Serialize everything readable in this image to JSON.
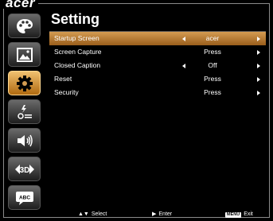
{
  "brand": {
    "logo_text": "acer"
  },
  "page": {
    "title": "Setting"
  },
  "sidebar": {
    "items": [
      {
        "icon": "palette-icon",
        "active": false
      },
      {
        "icon": "image-icon",
        "active": false
      },
      {
        "icon": "gear-icon",
        "active": true
      },
      {
        "icon": "power-management-icon",
        "active": false
      },
      {
        "icon": "speaker-icon",
        "active": false
      },
      {
        "icon": "3d-icon",
        "active": false,
        "text": "3D"
      },
      {
        "icon": "language-icon",
        "active": false,
        "text": "ABC"
      }
    ]
  },
  "menu": {
    "rows": [
      {
        "label": "Startup Screen",
        "value": "acer",
        "has_left_arrow": true,
        "selected": true
      },
      {
        "label": "Screen Capture",
        "value": "Press",
        "has_left_arrow": false,
        "selected": false
      },
      {
        "label": "Closed Caption",
        "value": "Off",
        "has_left_arrow": true,
        "selected": false
      },
      {
        "label": "Reset",
        "value": "Press",
        "has_left_arrow": false,
        "selected": false
      },
      {
        "label": "Security",
        "value": "Press",
        "has_left_arrow": false,
        "selected": false
      }
    ]
  },
  "footer": {
    "select_label": "Select",
    "enter_label": "Enter",
    "menu_key": "MENU",
    "exit_label": "Exit"
  },
  "colors": {
    "accent_gradient_top": "#d49c52",
    "accent_gradient_bottom": "#9a5e1c",
    "background": "#000000"
  }
}
